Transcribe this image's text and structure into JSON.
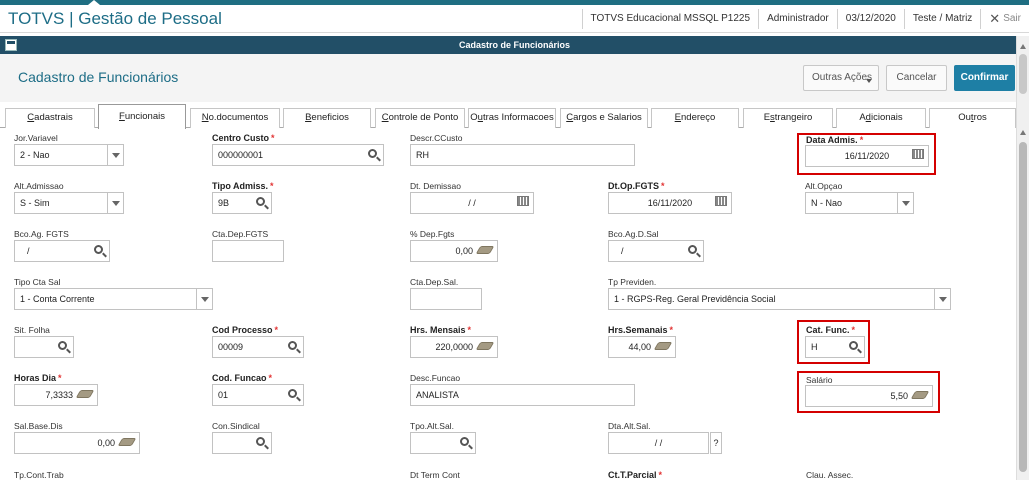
{
  "app": {
    "title": "TOTVS | Gestão de Pessoal",
    "environment": "TOTVS Educacional MSSQL P1225",
    "user": "Administrador",
    "date": "03/12/2020",
    "company": "Teste / Matriz",
    "logout": "Sair"
  },
  "window": {
    "title": "Cadastro de Funcionários"
  },
  "form": {
    "title": "Cadastro de Funcionários",
    "buttons": {
      "outras": "Outras Ações",
      "cancel": "Cancelar",
      "confirm": "Confirmar"
    }
  },
  "tabs": [
    {
      "pre": "",
      "u": "C",
      "post": "adastrais"
    },
    {
      "pre": "",
      "u": "F",
      "post": "uncionais"
    },
    {
      "pre": "",
      "u": "N",
      "post": "o.documentos"
    },
    {
      "pre": "",
      "u": "B",
      "post": "eneficios"
    },
    {
      "pre": "",
      "u": "C",
      "post": "ontrole de Ponto"
    },
    {
      "pre": "O",
      "u": "u",
      "post": "tras Informacoes"
    },
    {
      "pre": "",
      "u": "C",
      "post": "argos e Salarios"
    },
    {
      "pre": "",
      "u": "E",
      "post": "ndereço"
    },
    {
      "pre": "E",
      "u": "s",
      "post": "trangeiro"
    },
    {
      "pre": "A",
      "u": "d",
      "post": "icionais"
    },
    {
      "pre": "Ou",
      "u": "t",
      "post": "ros"
    }
  ],
  "fields": {
    "jor_variavel": {
      "label": "Jor.Variavel",
      "value": "2 - Nao"
    },
    "centro_custo": {
      "label": "Centro Custo",
      "value": "000000001"
    },
    "descr_ccusto": {
      "label": "Descr.CCusto",
      "value": "RH"
    },
    "data_admis": {
      "label": "Data Admis.",
      "value": "16/11/2020"
    },
    "alt_admissao": {
      "label": "Alt.Admissao",
      "value": "S - Sim"
    },
    "tipo_admiss": {
      "label": "Tipo Admiss.",
      "value": "9B"
    },
    "dt_demissao": {
      "label": "Dt. Demissao",
      "value": "/ /"
    },
    "dt_op_fgts": {
      "label": "Dt.Op.FGTS",
      "value": "16/11/2020"
    },
    "alt_opcao": {
      "label": "Alt.Opçao",
      "value": "N - Nao"
    },
    "bco_ag_fgts": {
      "label": "Bco.Ag. FGTS",
      "value": "/"
    },
    "cta_dep_fgts": {
      "label": "Cta.Dep.FGTS",
      "value": ""
    },
    "pct_dep_fgts": {
      "label": "% Dep.Fgts",
      "value": "0,00"
    },
    "bco_ag_d_sal": {
      "label": "Bco.Ag.D.Sal",
      "value": "/"
    },
    "tipo_cta_sal": {
      "label": "Tipo Cta Sal",
      "value": "1 - Conta Corrente"
    },
    "cta_dep_sal": {
      "label": "Cta.Dep.Sal.",
      "value": ""
    },
    "tp_previden": {
      "label": "Tp Previden.",
      "value": "1 - RGPS-Reg. Geral Previdência Social"
    },
    "sit_folha": {
      "label": "Sit. Folha",
      "value": ""
    },
    "cod_processo": {
      "label": "Cod Processo",
      "value": "00009"
    },
    "hrs_mensais": {
      "label": "Hrs. Mensais",
      "value": "220,0000"
    },
    "hrs_semanais": {
      "label": "Hrs.Semanais",
      "value": "44,00"
    },
    "cat_func": {
      "label": "Cat. Func.",
      "value": "H"
    },
    "horas_dia": {
      "label": "Horas Dia",
      "value": "7,3333"
    },
    "cod_funcao": {
      "label": "Cod. Funcao",
      "value": "01"
    },
    "desc_funcao": {
      "label": "Desc.Funcao",
      "value": "ANALISTA"
    },
    "salario": {
      "label": "Salário",
      "value": "5,50"
    },
    "sal_base_dis": {
      "label": "Sal.Base.Dis",
      "value": "0,00"
    },
    "con_sindical": {
      "label": "Con.Sindical",
      "value": ""
    },
    "tpo_alt_sal": {
      "label": "Tpo.Alt.Sal.",
      "value": ""
    },
    "dta_alt_sal": {
      "label": "Dta.Alt.Sal.",
      "value": "/ /"
    },
    "dta_alt_sal_help": "?",
    "tp_cont_trab": {
      "label": "Tp.Cont.Trab"
    },
    "dt_term_cont": {
      "label": "Dt Term Cont"
    },
    "ct_t_parcial": {
      "label": "Ct.T.Parcial"
    },
    "clau_assec": {
      "label": "Clau. Assec."
    }
  },
  "required_marker": "*",
  "colors": {
    "brand": "#1d6d86",
    "titlebar": "#224f67",
    "confirm": "#1e7fa5",
    "required": "#e23333",
    "highlight": "#d40000"
  }
}
